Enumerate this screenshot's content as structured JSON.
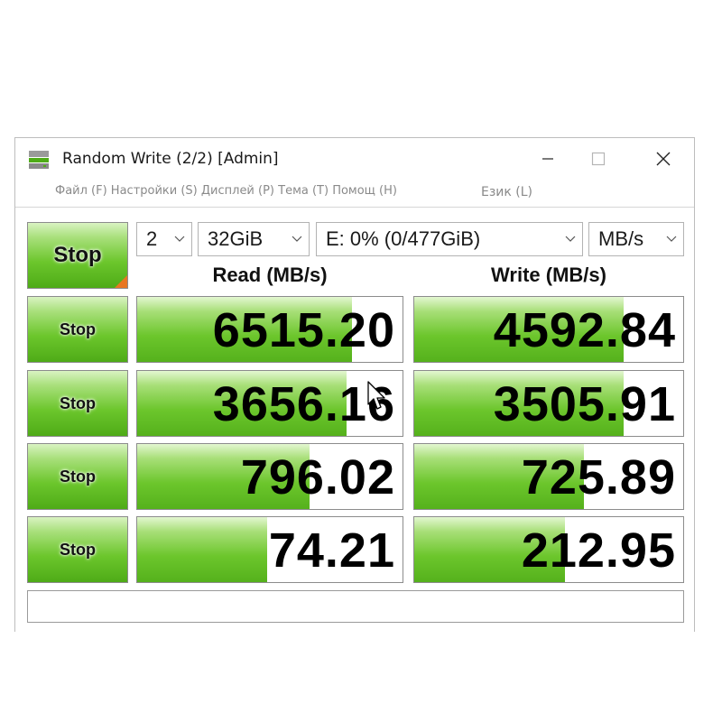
{
  "window": {
    "title": "Random Write (2/2) [Admin]",
    "menu_left": "Файл (F) Настройки (S) Дисплей (P) Тема (T) Помощ (H)",
    "menu_right": "Език (L)"
  },
  "controls": {
    "main_button": "Stop",
    "count": "2",
    "size": "32GiB",
    "drive": "E: 0% (0/477GiB)",
    "unit": "MB/s"
  },
  "headers": {
    "read": "Read (MB/s)",
    "write": "Write (MB/s)"
  },
  "rows": [
    {
      "button": "Stop",
      "read": "6515.20",
      "write": "4592.84",
      "read_fill": 0.81,
      "write_fill": 0.78
    },
    {
      "button": "Stop",
      "read": "3656.16",
      "write": "3505.91",
      "read_fill": 0.79,
      "write_fill": 0.78
    },
    {
      "button": "Stop",
      "read": "796.02",
      "write": "725.89",
      "read_fill": 0.65,
      "write_fill": 0.63
    },
    {
      "button": "Stop",
      "read": "74.21",
      "write": "212.95",
      "read_fill": 0.49,
      "write_fill": 0.56
    }
  ],
  "colors": {
    "accent_green": "#6cc62c",
    "corner_orange": "#e87722"
  },
  "icons": [
    "drive-icon",
    "minimize-icon",
    "maximize-icon",
    "close-icon",
    "chevron-down-icon",
    "mouse-cursor-icon"
  ]
}
